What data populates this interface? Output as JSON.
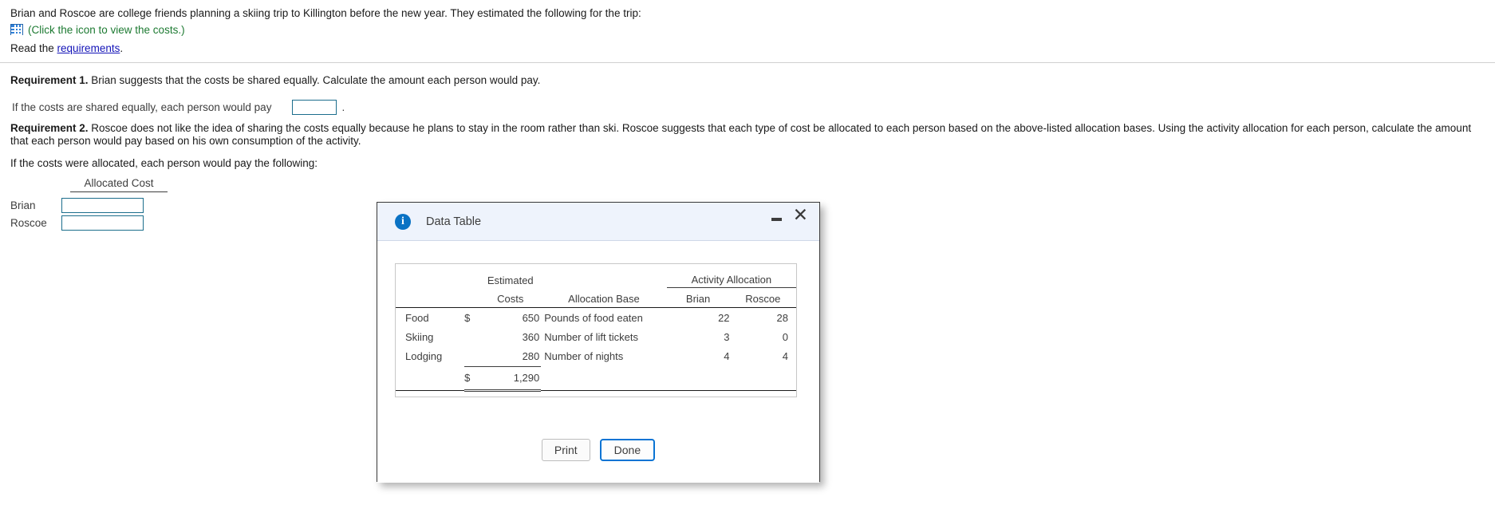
{
  "problem": {
    "intro": "Brian and Roscoe are college friends planning a skiing trip to Killington before the new year. They estimated the following for the trip:",
    "icon_name": "grid-table-icon",
    "icon_caption": "(Click the icon to view the costs.)",
    "read_prefix": "Read the ",
    "read_link": "requirements",
    "read_suffix": "."
  },
  "requirement1": {
    "label": "Requirement 1.",
    "text": " Brian suggests that the costs be shared equally. Calculate the amount each person would pay.",
    "answer_prompt": "If the costs are shared equally, each person would pay",
    "answer_value": "",
    "answer_placeholder": "",
    "trailing_period": "."
  },
  "requirement2": {
    "label": "Requirement 2.",
    "text": " Roscoe does not like the idea of sharing the costs equally because he plans to stay in the room rather than ski. Roscoe suggests that each type of cost be allocated to each person based on the above-listed allocation bases. Using the activity allocation for each person, calculate the amount that each person would pay based on his own consumption of the activity.",
    "answer_prompt": "If the costs were allocated, each person would pay the following:",
    "table": {
      "header": "Allocated Cost",
      "rows": [
        {
          "name": "Brian",
          "value": ""
        },
        {
          "name": "Roscoe",
          "value": ""
        }
      ]
    }
  },
  "dialog": {
    "title": "Data Table",
    "info_icon": "info-icon",
    "minimize_icon": "minimize-icon",
    "close_icon": "close-icon",
    "buttons": {
      "print": "Print",
      "done": "Done"
    },
    "table": {
      "group_headers": {
        "estimated": "Estimated",
        "activity_allocation": "Activity Allocation"
      },
      "columns": [
        "",
        "",
        "Costs",
        "Allocation Base",
        "Brian",
        "Roscoe"
      ],
      "rows": [
        {
          "label": "Food",
          "dollar": "$",
          "cost": "650",
          "base": "Pounds of food eaten",
          "brian": "22",
          "roscoe": "28"
        },
        {
          "label": "Skiing",
          "dollar": "",
          "cost": "360",
          "base": "Number of lift tickets",
          "brian": "3",
          "roscoe": "0"
        },
        {
          "label": "Lodging",
          "dollar": "",
          "cost": "280",
          "base": "Number of nights",
          "brian": "4",
          "roscoe": "4"
        }
      ],
      "total": {
        "dollar": "$",
        "cost": "1,290"
      }
    }
  },
  "colors": {
    "link": "#1414b8",
    "icon_caption": "#1d7a32",
    "input_border": "#1c6e8c",
    "primary_button_border": "#0a74d4",
    "info_icon": "#0a72c4",
    "dialog_header_bg": "#eef3fc"
  }
}
